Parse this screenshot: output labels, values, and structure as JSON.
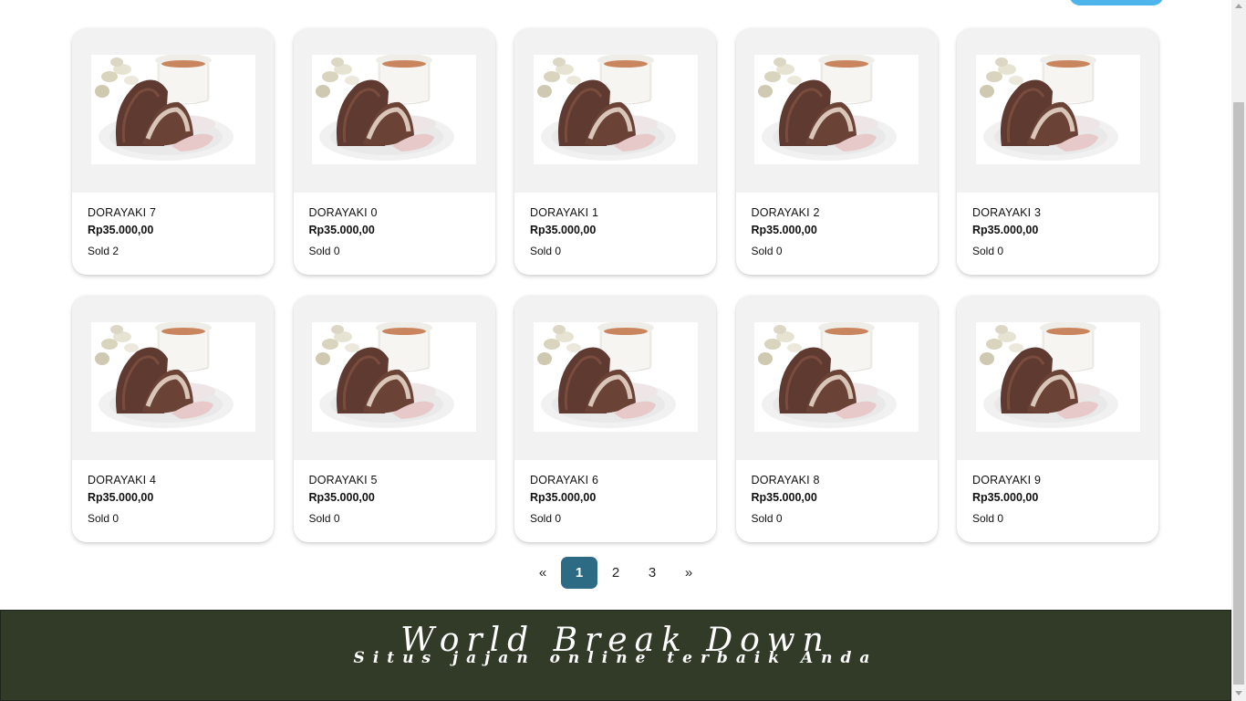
{
  "products": [
    {
      "name": "DORAYAKI 7",
      "price": "Rp35.000,00",
      "sold": "Sold 2"
    },
    {
      "name": "DORAYAKI 0",
      "price": "Rp35.000,00",
      "sold": "Sold 0"
    },
    {
      "name": "DORAYAKI 1",
      "price": "Rp35.000,00",
      "sold": "Sold 0"
    },
    {
      "name": "DORAYAKI 2",
      "price": "Rp35.000,00",
      "sold": "Sold 0"
    },
    {
      "name": "DORAYAKI 3",
      "price": "Rp35.000,00",
      "sold": "Sold 0"
    },
    {
      "name": "DORAYAKI 4",
      "price": "Rp35.000,00",
      "sold": "Sold 0"
    },
    {
      "name": "DORAYAKI 5",
      "price": "Rp35.000,00",
      "sold": "Sold 0"
    },
    {
      "name": "DORAYAKI 6",
      "price": "Rp35.000,00",
      "sold": "Sold 0"
    },
    {
      "name": "DORAYAKI 8",
      "price": "Rp35.000,00",
      "sold": "Sold 0"
    },
    {
      "name": "DORAYAKI 9",
      "price": "Rp35.000,00",
      "sold": "Sold 0"
    }
  ],
  "pagination": {
    "prev": "«",
    "pages": [
      "1",
      "2",
      "3"
    ],
    "current": "1",
    "next": "»"
  },
  "footer": {
    "title": "World Break Down",
    "subtitle": "Situs jajan online terbaik Anda"
  },
  "colors": {
    "accent": "#2d6a84",
    "footer_bg": "#323b28",
    "top_button": "#4db4ec",
    "card_media_bg": "#f2f2f2"
  },
  "icons": {
    "product_image": "dorayaki-photo"
  }
}
